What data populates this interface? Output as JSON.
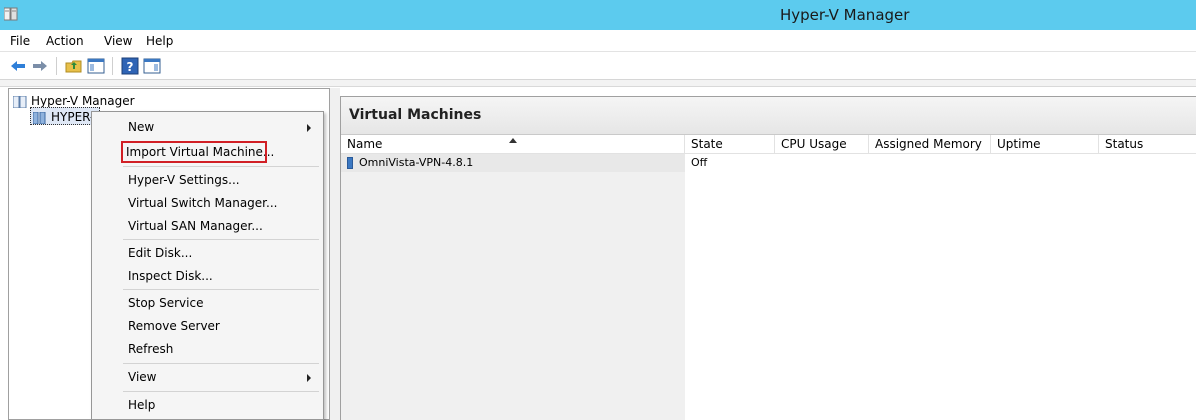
{
  "window": {
    "title": "Hyper-V Manager"
  },
  "menu": [
    "File",
    "Action",
    "View",
    "Help"
  ],
  "tree": {
    "root": "Hyper-V Manager",
    "server": "HYPER-V"
  },
  "panel": {
    "title": "Virtual Machines"
  },
  "columns": [
    "Name",
    "State",
    "CPU Usage",
    "Assigned Memory",
    "Uptime",
    "Status"
  ],
  "vms": [
    {
      "name": "OmniVista-VPN-4.8.1",
      "state": "Off"
    }
  ],
  "context_menu": {
    "items": [
      {
        "label": "New",
        "submenu": true
      },
      {
        "label": "Import Virtual Machine...",
        "highlighted": true
      },
      {
        "label": "Hyper-V Settings..."
      },
      {
        "label": "Virtual Switch Manager..."
      },
      {
        "label": "Virtual SAN Manager..."
      },
      {
        "label": "Edit Disk..."
      },
      {
        "label": "Inspect Disk..."
      },
      {
        "label": "Stop Service"
      },
      {
        "label": "Remove Server"
      },
      {
        "label": "Refresh"
      },
      {
        "label": "View",
        "submenu": true
      },
      {
        "label": "Help"
      }
    ]
  },
  "icons": {
    "back": "back-arrow-icon",
    "forward": "forward-arrow-icon",
    "up": "folder-up-icon",
    "show_hide_tree": "show-hide-console-tree-icon",
    "help": "help-icon",
    "show_hide_action": "show-hide-action-pane-icon"
  },
  "colors": {
    "titlebar": "#5ccbee",
    "highlight_border": "#d11f25"
  }
}
